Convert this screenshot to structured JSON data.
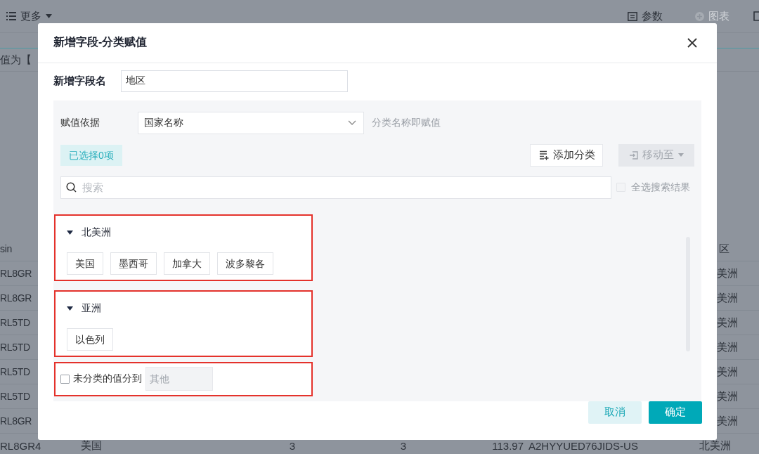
{
  "background": {
    "toolbar": {
      "more": "更多",
      "params": "参数",
      "chart": {
        "label": "图表",
        "disabled": true
      }
    },
    "filter_text": "值为【",
    "table": {
      "header_first": "sin",
      "header_last": "区",
      "rows": [
        {
          "first": "RL8GR",
          "last": "美洲"
        },
        {
          "first": "RL8GR",
          "last": "美洲"
        },
        {
          "first": "RL5TD",
          "last": "美洲"
        },
        {
          "first": "RL5TD",
          "last": "美洲"
        },
        {
          "first": "RL5TD",
          "last": "美洲"
        },
        {
          "first": "RL5TD",
          "last": "美洲"
        },
        {
          "first": "RL8GR",
          "last": "美洲"
        },
        {
          "first": "RL8GR4",
          "middle": [
            "美国",
            "3",
            "3",
            "113.97",
            "A2HYYUED76JIDS-US"
          ],
          "last": "北美洲"
        }
      ]
    }
  },
  "dialog": {
    "title": "新增字段-分类赋值",
    "field_name": {
      "label": "新增字段名",
      "value": "地区"
    },
    "basis": {
      "label": "赋值依据",
      "value": "国家名称",
      "hint": "分类名称即赋值"
    },
    "selected_count": "已选择0项",
    "add_button": "添加分类",
    "move_button": {
      "label": "移动至",
      "disabled": true
    },
    "search": {
      "placeholder": "搜索"
    },
    "select_all": {
      "label": "全选搜索结果",
      "checked": false,
      "disabled": true
    },
    "groups": [
      {
        "name": "北美洲",
        "expanded": true,
        "highlighted": true,
        "items": [
          "美国",
          "墨西哥",
          "加拿大",
          "波多黎各"
        ]
      },
      {
        "name": "亚洲",
        "expanded": true,
        "highlighted": true,
        "items": [
          "以色列"
        ]
      }
    ],
    "unclassified": {
      "label": "未分类的值分到",
      "checked": false,
      "placeholder": "其他",
      "highlighted": true
    },
    "buttons": [
      {
        "label": "取消",
        "kind": "secondary"
      },
      {
        "label": "确定",
        "kind": "primary"
      }
    ]
  }
}
